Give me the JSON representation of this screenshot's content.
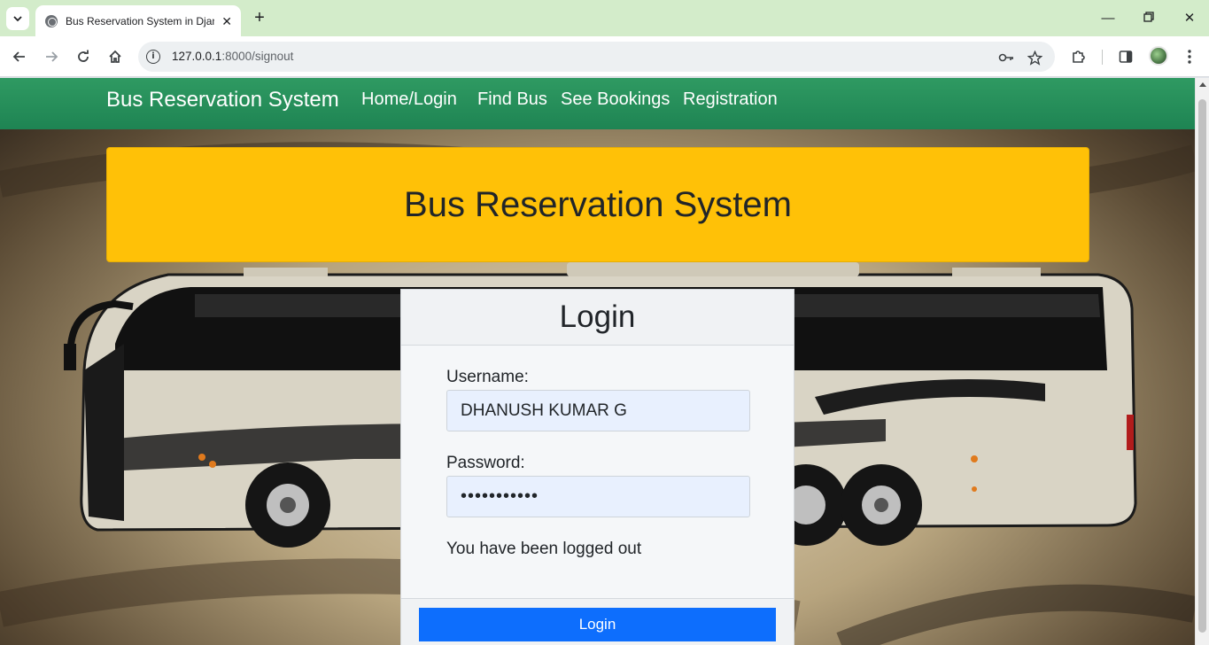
{
  "browser": {
    "tab_title": "Bus Reservation System in Djan",
    "url_host": "127.0.0.1",
    "url_rest": ":8000/signout"
  },
  "navbar": {
    "brand": "Bus Reservation System",
    "links": [
      "Home/Login",
      "Find Bus",
      "See Bookings",
      "Registration"
    ]
  },
  "hero": {
    "title": "Bus Reservation System"
  },
  "login": {
    "title": "Login",
    "username_label": "Username:",
    "username_value": "DHANUSH KUMAR G",
    "password_label": "Password:",
    "password_value": "•••••••••••",
    "message": "You have been logged out",
    "button": "Login"
  },
  "colors": {
    "navbar": "#1e8453",
    "hero": "#ffc107",
    "button": "#0d6efd",
    "tabbar": "#d3ecca"
  }
}
